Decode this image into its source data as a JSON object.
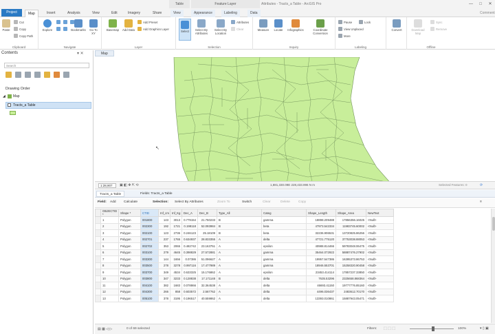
{
  "titlebar": {
    "context_table": "Table",
    "context_feature_layer": "Feature Layer",
    "title": "Attributes - Tracts_a Table - ArcGIS Pro",
    "minimize": "—",
    "maximize": "□",
    "close": "✕"
  },
  "tabs": [
    "Project",
    "Map",
    "Insert",
    "Analysis",
    "View",
    "Edit",
    "Imagery",
    "Share",
    "View",
    "Appearance",
    "Labeling",
    "Data"
  ],
  "tab_right": "Comments",
  "ribbon": {
    "clipboard": {
      "label": "Clipboard",
      "paste": "Paste",
      "cut": "Cut",
      "copy": "Copy",
      "copy_path": "Copy Path"
    },
    "navigate": {
      "label": "Navigate",
      "explore": "Explore",
      "bookmarks": "Bookmarks",
      "goto": "Go To XY"
    },
    "layer": {
      "label": "Layer",
      "basemap": "Basemap",
      "add_data": "Add Data",
      "add_preset": "Add Preset",
      "add_graphics": "Add Graphics Layer"
    },
    "selection": {
      "label": "Selection",
      "select": "Select",
      "select_by_attributes": "Select By Attributes",
      "select_by_location": "Select By Location",
      "attributes": "Attributes",
      "clear": "Clear"
    },
    "inquiry": {
      "label": "Inquiry",
      "measure": "Measure",
      "locate": "Locate",
      "infographics": "Infographics",
      "coordinate_conversion": "Coordinate Conversion"
    },
    "labeling": {
      "label": "Labeling",
      "pause": "Pause",
      "lock": "Lock",
      "view_unplaced": "View Unplaced",
      "more": "More"
    },
    "convert": "Convert",
    "offline": {
      "label": "Offline",
      "download_map": "Download Map",
      "sync": "Sync",
      "remove": "Remove"
    }
  },
  "contents": {
    "title": "Contents",
    "search_placeholder": "Search",
    "drawing_order": "Drawing Order",
    "map_item": "Map",
    "layer_item": "Tracts_a Table"
  },
  "map": {
    "tab_label": "Map",
    "fill_color": "#c8ee9a",
    "stroke_color": "#6f8f5a"
  },
  "map_status": {
    "scale": "1:28,907",
    "coordinates": "1,881,330.09E 228,433.996 N m",
    "selected_features": "Selected Features: 0"
  },
  "table_tabs": {
    "map_tab": "Map",
    "table_tab": "Tracts_a Table",
    "fields_tab": "Fields: Tracts_a Table"
  },
  "table_toolbar": {
    "field_label": "Field:",
    "add": "Add",
    "calculate": "Calculate",
    "selection_label": "Selection:",
    "select_by_attributes": "Select By Attributes",
    "zoom_to": "Zoom To",
    "switch": "Switch",
    "clear": "Clear",
    "delete": "Delete",
    "copy": "Copy"
  },
  "table": {
    "columns": [
      "OBJECTID *",
      "Shape *",
      "CTID",
      "Inf_cm",
      "Inf_Kg",
      "Dec_A",
      "Dec_B",
      "Type_All",
      "Categ",
      "Shape_Length",
      "Shape_Area",
      "NewText"
    ],
    "rows": [
      [
        "1",
        "Polygon",
        "001800",
        "143",
        "3013",
        "0.779154",
        "21.750233",
        "B",
        "gamma",
        "18898.209488",
        "17856356.16025",
        "<Null>"
      ],
      [
        "2",
        "Polygon",
        "002300",
        "192",
        "1721",
        "0.198118",
        "52.093984",
        "B",
        "beta",
        "47973.542334",
        "11983745.60002",
        "<Null>"
      ],
      [
        "3",
        "Polygon",
        "002100",
        "123",
        "2736",
        "0.246123",
        "25.18109",
        "B",
        "beta",
        "32236.906531",
        "13720825.86256",
        "<Null>"
      ],
      [
        "4",
        "Polygon",
        "002701",
        "237",
        "1765",
        "0.634937",
        "28.833355",
        "A",
        "delta",
        "47721.775120",
        "37753038.88053",
        "<Null>"
      ],
      [
        "5",
        "Polygon",
        "002702",
        "353",
        "2065",
        "0.482742",
        "23.163751",
        "A",
        "epsilon",
        "40988.814466",
        "59783048.06475",
        "<Null>"
      ],
      [
        "6",
        "Polygon",
        "003100",
        "279",
        "4645",
        "0.398829",
        "27.572881",
        "A",
        "gamma",
        "35464.072922",
        "58887476.27902",
        "<Null>"
      ],
      [
        "7",
        "Polygon",
        "003300",
        "144",
        "1656",
        "0.07386",
        "51.096627",
        "A",
        "gamma",
        "19957.547386",
        "16395373.86753",
        "<Null>"
      ],
      [
        "8",
        "Polygon",
        "003500",
        "278",
        "3278",
        "0.997116",
        "17.477989",
        "A",
        "gamma",
        "18946.553701",
        "15258320.90458",
        "<Null>"
      ],
      [
        "9",
        "Polygon",
        "003700",
        "349",
        "4534",
        "0.633325",
        "15.176862",
        "A",
        "epsilon",
        "23453.414114",
        "17857237.33850",
        "<Null>"
      ],
      [
        "10",
        "Polygon",
        "003800",
        "347",
        "3233",
        "0.128838",
        "17.171148",
        "B",
        "delta",
        "7635.53296",
        "2325658.868364",
        "<Null>"
      ],
      [
        "11",
        "Polygon",
        "004100",
        "382",
        "1683",
        "0.078866",
        "32.364538",
        "A",
        "delta",
        "46693.41150",
        "19777776.85160",
        "<Null>"
      ],
      [
        "12",
        "Polygon",
        "004300",
        "266",
        "858",
        "0.603572",
        "2.567762",
        "A",
        "delta",
        "4496.036437",
        "2483612.70170",
        "<Null>"
      ],
      [
        "13",
        "Polygon",
        "005100",
        "378",
        "3195",
        "0.196517",
        "40.559862",
        "A",
        "delta",
        "13393.010861",
        "15887943.05471",
        "<Null>"
      ]
    ]
  },
  "table_status": {
    "selected_text": "0 of 69 selected",
    "filters_label": "Filters:",
    "zoom": "100%"
  }
}
